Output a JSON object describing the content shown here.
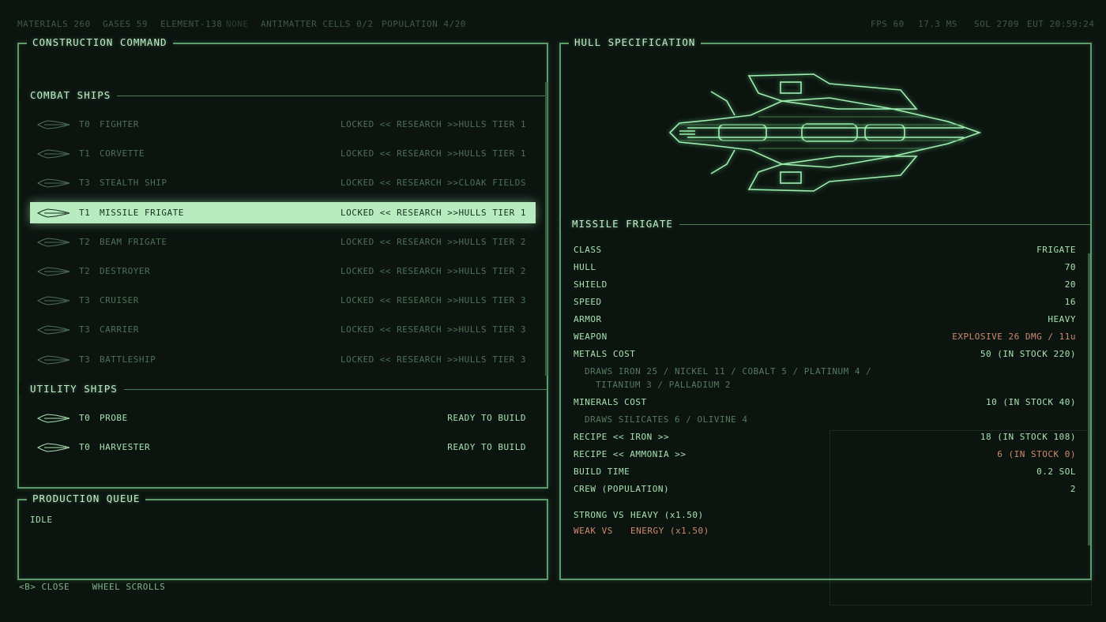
{
  "topbar": {
    "materials": "MATERIALS 260",
    "gases": "GASES 59",
    "element": "ELEMENT-138",
    "element_state": "NONE",
    "antimatter": "ANTIMATTER CELLS 0/2",
    "population": "POPULATION 4/20",
    "fps": "FPS 60",
    "ms": "17.3 MS",
    "sol": "SOL 2709",
    "eut": "EUT 20:59:24"
  },
  "construction": {
    "title": "CONSTRUCTION COMMAND",
    "combat_title": "COMBAT SHIPS",
    "combat": [
      {
        "tier": "T0",
        "name": "FIGHTER",
        "status": "LOCKED << RESEARCH  >>HULLS TIER 1",
        "icon": "fighter-icon"
      },
      {
        "tier": "T1",
        "name": "CORVETTE",
        "status": "LOCKED << RESEARCH  >>HULLS TIER 1",
        "icon": "corvette-icon"
      },
      {
        "tier": "T3",
        "name": "STEALTH SHIP",
        "status": "LOCKED << RESEARCH  >>CLOAK FIELDS",
        "icon": "stealth-ship-icon"
      },
      {
        "tier": "T1",
        "name": "MISSILE FRIGATE",
        "status": "LOCKED << RESEARCH  >>HULLS TIER 1",
        "icon": "missile-frigate-icon"
      },
      {
        "tier": "T2",
        "name": "BEAM FRIGATE",
        "status": "LOCKED << RESEARCH  >>HULLS TIER 2",
        "icon": "beam-frigate-icon"
      },
      {
        "tier": "T2",
        "name": "DESTROYER",
        "status": "LOCKED << RESEARCH  >>HULLS TIER 2",
        "icon": "destroyer-icon"
      },
      {
        "tier": "T3",
        "name": "CRUISER",
        "status": "LOCKED << RESEARCH  >>HULLS TIER 3",
        "icon": "cruiser-icon"
      },
      {
        "tier": "T3",
        "name": "CARRIER",
        "status": "LOCKED << RESEARCH  >>HULLS TIER 3",
        "icon": "carrier-icon"
      },
      {
        "tier": "T3",
        "name": "BATTLESHIP",
        "status": "LOCKED << RESEARCH  >>HULLS TIER 3",
        "icon": "battleship-icon"
      }
    ],
    "utility_title": "UTILITY SHIPS",
    "utility": [
      {
        "tier": "T0",
        "name": "PROBE",
        "status": "READY TO BUILD",
        "icon": "probe-icon"
      },
      {
        "tier": "T0",
        "name": "HARVESTER",
        "status": "READY TO BUILD",
        "icon": "harvester-icon"
      }
    ]
  },
  "queue": {
    "title": "PRODUCTION QUEUE",
    "status": "IDLE"
  },
  "hints": {
    "close": "<B> CLOSE",
    "scroll": "WHEEL SCROLLS"
  },
  "hull": {
    "title": "HULL SPECIFICATION",
    "ship_name": "MISSILE FRIGATE",
    "stats": [
      {
        "label": "CLASS",
        "value": "FRIGATE"
      },
      {
        "label": "HULL",
        "value": "70"
      },
      {
        "label": "SHIELD",
        "value": "20"
      },
      {
        "label": "SPEED",
        "value": "16"
      },
      {
        "label": "ARMOR",
        "value": "HEAVY"
      },
      {
        "label": "WEAPON",
        "value": "EXPLOSIVE 26 DMG / 11u"
      },
      {
        "label": "METALS COST",
        "value": "50  (IN STOCK 220)"
      }
    ],
    "metals_note_1": "DRAWS IRON 25 / NICKEL 11 / COBALT 5 / PLATINUM 4 /",
    "metals_note_2": "TITANIUM 3 / PALLADIUM 2",
    "minerals": {
      "label": "MINERALS COST",
      "value": "10  (IN STOCK 40)"
    },
    "minerals_note": "DRAWS SILICATES 6 / OLIVINE 4",
    "recipe_iron": {
      "label": "RECIPE << IRON >>",
      "value": "18  (IN STOCK 108)"
    },
    "recipe_ammonia": {
      "label": "RECIPE << AMMONIA >>",
      "value": "6  (IN STOCK 0)"
    },
    "build_time": {
      "label": "BUILD TIME",
      "value": "0.2 SOL"
    },
    "crew": {
      "label": "CREW (POPULATION)",
      "value": "2"
    },
    "strong": {
      "label": "STRONG VS",
      "value": "HEAVY (x1.50)"
    },
    "weak": {
      "label": "WEAK VS",
      "value": "ENERGY (x1.50)"
    }
  },
  "colors": {
    "accent": "#b8ecc0",
    "line": "#5d9a6a",
    "warn": "#d08a6e",
    "background": "#0c1410"
  }
}
